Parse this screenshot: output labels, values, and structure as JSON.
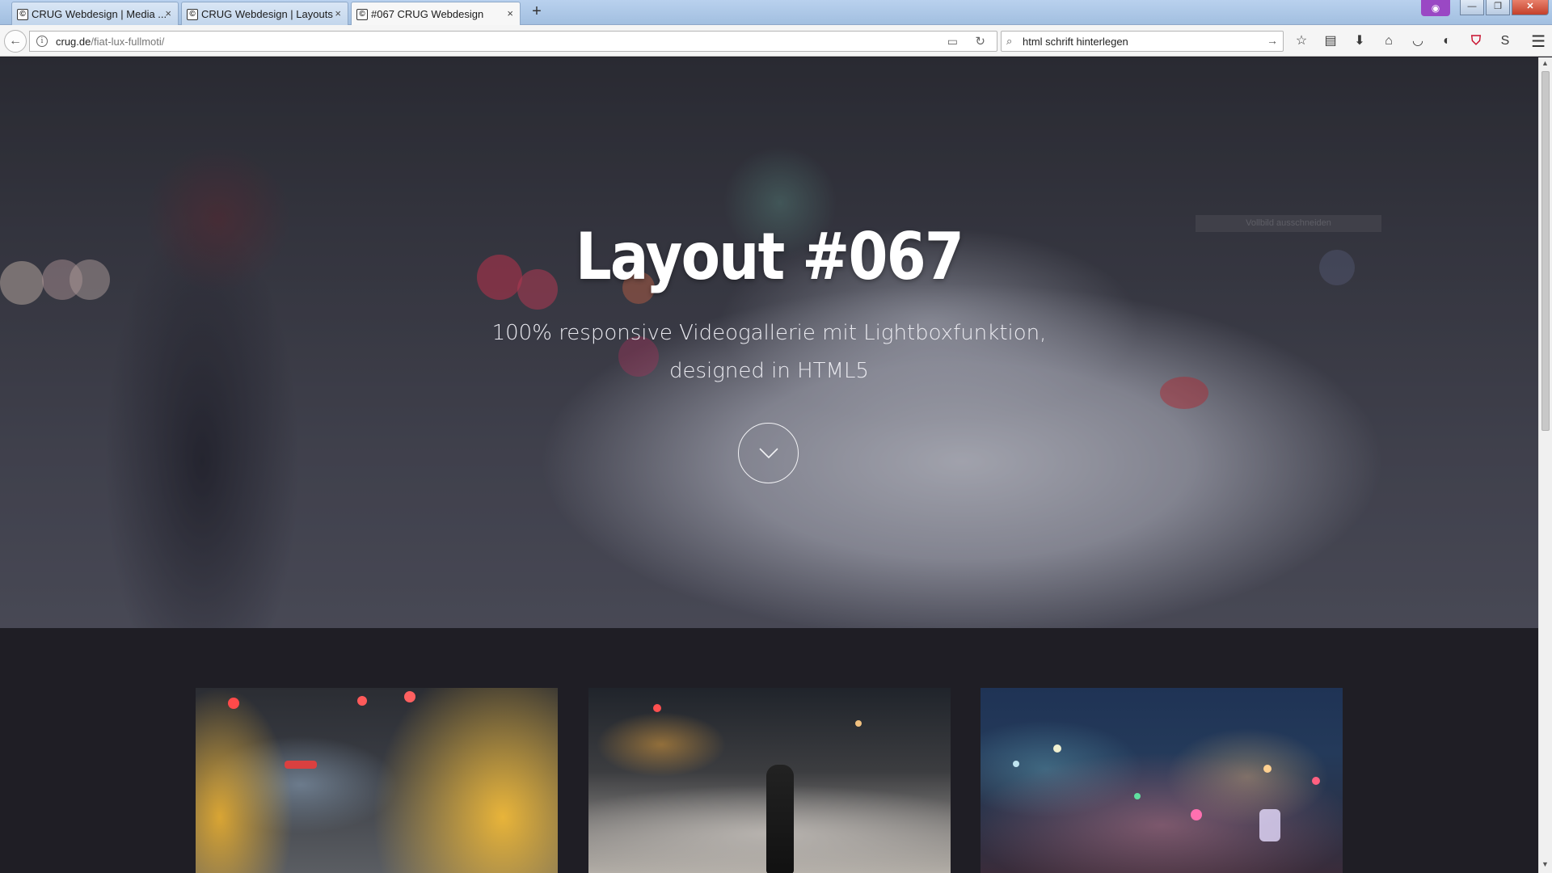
{
  "browser": {
    "tabs": [
      {
        "title": "CRUG Webdesign | Media ...",
        "active": false
      },
      {
        "title": "CRUG Webdesign | Layouts",
        "active": false
      },
      {
        "title": "#067 CRUG Webdesign",
        "active": true
      }
    ],
    "favicon_glyph": "©",
    "new_tab_glyph": "+",
    "close_glyph": "×",
    "url_host": "crug.de",
    "url_path": "/fiat-lux-fullmoti/",
    "search_query": "html schrift hinterlegen",
    "window_controls": {
      "minimize": "—",
      "restore": "❐",
      "close": "✕"
    }
  },
  "page": {
    "tooltip": "Vollbild ausschneiden",
    "hero_title": "Layout #067",
    "hero_sub_line1": "100% responsive Videogallerie mit Lightboxfunktion,",
    "hero_sub_line2": "designed in HTML5"
  },
  "colors": {
    "tab_strip": "#a9c3e3",
    "page_background": "#1e1d24",
    "masquerade_accent": "#9a48c4",
    "ublock_red": "#c8102e"
  }
}
